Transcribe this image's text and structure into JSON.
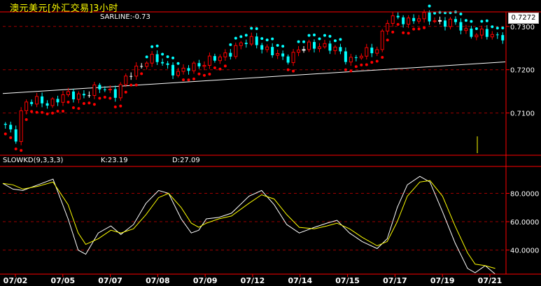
{
  "title": "澳元美元[外汇交易]3小时",
  "upper_indicator": {
    "name": "SARLINE",
    "value_text": "SARLINE:-0.73"
  },
  "lower_indicator": {
    "name": "SLOWKD(9,3,3,3)",
    "k_text": "K:23.19",
    "d_text": "D:27.09"
  },
  "last_price_label": "0.7272",
  "colors": {
    "background": "#000000",
    "frame": "#ff0000",
    "grid": "#a00000",
    "up_candle": "#ff0000",
    "down_candle": "#00ffff",
    "doji": "#ffffff",
    "sar_below": "#ff0000",
    "sar_above": "#00ffff",
    "trendline": "#ffffff",
    "k_line": "#ffffff",
    "d_line": "#ffff00",
    "axis_text": "#ffffff",
    "volume_spike": "#ffff00"
  },
  "chart_data": [
    {
      "type": "candlestick",
      "title": "澳元美元[外汇交易]3小时",
      "ylim": [
        0.7004,
        0.7332
      ],
      "y_ticks": [
        "0.7100",
        "0.7200",
        "0.7300"
      ],
      "x_ticks": [
        "07/02",
        "07/05",
        "07/07",
        "07/08",
        "07/09",
        "07/12",
        "07/14",
        "07/15",
        "07/17",
        "07/19",
        "07/21"
      ],
      "grid": true,
      "series": [
        {
          "name": "SARLINE",
          "value": -0.73
        }
      ],
      "trendline": {
        "from": [
          0,
          0.7145
        ],
        "to": [
          1,
          0.7218
        ]
      },
      "last_price": 0.7272
    },
    {
      "type": "line",
      "title": "SLOWKD(9,3,3,3)",
      "ylim": [
        24,
        98
      ],
      "y_ticks": [
        "40.0000",
        "60.0000",
        "80.0000"
      ],
      "x_ticks": [
        "07/02",
        "07/05",
        "07/07",
        "07/08",
        "07/09",
        "07/12",
        "07/14",
        "07/15",
        "07/17",
        "07/19",
        "07/21"
      ],
      "grid": true,
      "series": [
        {
          "name": "K",
          "last": 23.19,
          "points": [
            [
              0,
              87
            ],
            [
              0.02,
              83
            ],
            [
              0.04,
              82
            ],
            [
              0.07,
              86
            ],
            [
              0.1,
              90
            ],
            [
              0.13,
              62
            ],
            [
              0.15,
              40
            ],
            [
              0.165,
              37
            ],
            [
              0.19,
              52
            ],
            [
              0.215,
              57
            ],
            [
              0.235,
              51
            ],
            [
              0.26,
              58
            ],
            [
              0.285,
              73
            ],
            [
              0.31,
              82
            ],
            [
              0.33,
              80
            ],
            [
              0.355,
              62
            ],
            [
              0.375,
              52
            ],
            [
              0.39,
              54
            ],
            [
              0.405,
              62
            ],
            [
              0.43,
              63
            ],
            [
              0.455,
              66
            ],
            [
              0.49,
              78
            ],
            [
              0.515,
              82
            ],
            [
              0.54,
              72
            ],
            [
              0.565,
              58
            ],
            [
              0.59,
              52
            ],
            [
              0.62,
              56
            ],
            [
              0.645,
              59
            ],
            [
              0.665,
              61
            ],
            [
              0.69,
              52
            ],
            [
              0.715,
              46
            ],
            [
              0.745,
              41
            ],
            [
              0.765,
              48
            ],
            [
              0.785,
              70
            ],
            [
              0.805,
              86
            ],
            [
              0.83,
              92
            ],
            [
              0.85,
              88
            ],
            [
              0.875,
              67
            ],
            [
              0.9,
              45
            ],
            [
              0.925,
              27
            ],
            [
              0.94,
              24
            ],
            [
              0.96,
              29
            ],
            [
              0.98,
              23
            ]
          ]
        },
        {
          "name": "D",
          "last": 27.09,
          "points": [
            [
              0,
              87
            ],
            [
              0.02,
              86
            ],
            [
              0.04,
              83
            ],
            [
              0.07,
              85
            ],
            [
              0.1,
              88
            ],
            [
              0.13,
              72
            ],
            [
              0.15,
              52
            ],
            [
              0.165,
              44
            ],
            [
              0.19,
              48
            ],
            [
              0.215,
              54
            ],
            [
              0.235,
              52
            ],
            [
              0.26,
              55
            ],
            [
              0.285,
              65
            ],
            [
              0.31,
              77
            ],
            [
              0.33,
              80
            ],
            [
              0.355,
              70
            ],
            [
              0.375,
              59
            ],
            [
              0.39,
              56
            ],
            [
              0.405,
              59
            ],
            [
              0.43,
              62
            ],
            [
              0.455,
              64
            ],
            [
              0.49,
              73
            ],
            [
              0.515,
              79
            ],
            [
              0.54,
              76
            ],
            [
              0.565,
              65
            ],
            [
              0.59,
              56
            ],
            [
              0.62,
              55
            ],
            [
              0.645,
              57
            ],
            [
              0.665,
              59
            ],
            [
              0.69,
              55
            ],
            [
              0.715,
              49
            ],
            [
              0.745,
              43
            ],
            [
              0.765,
              46
            ],
            [
              0.785,
              60
            ],
            [
              0.805,
              78
            ],
            [
              0.83,
              88
            ],
            [
              0.85,
              89
            ],
            [
              0.875,
              78
            ],
            [
              0.9,
              57
            ],
            [
              0.925,
              38
            ],
            [
              0.94,
              30
            ],
            [
              0.96,
              29
            ],
            [
              0.98,
              27
            ]
          ]
        }
      ]
    }
  ]
}
